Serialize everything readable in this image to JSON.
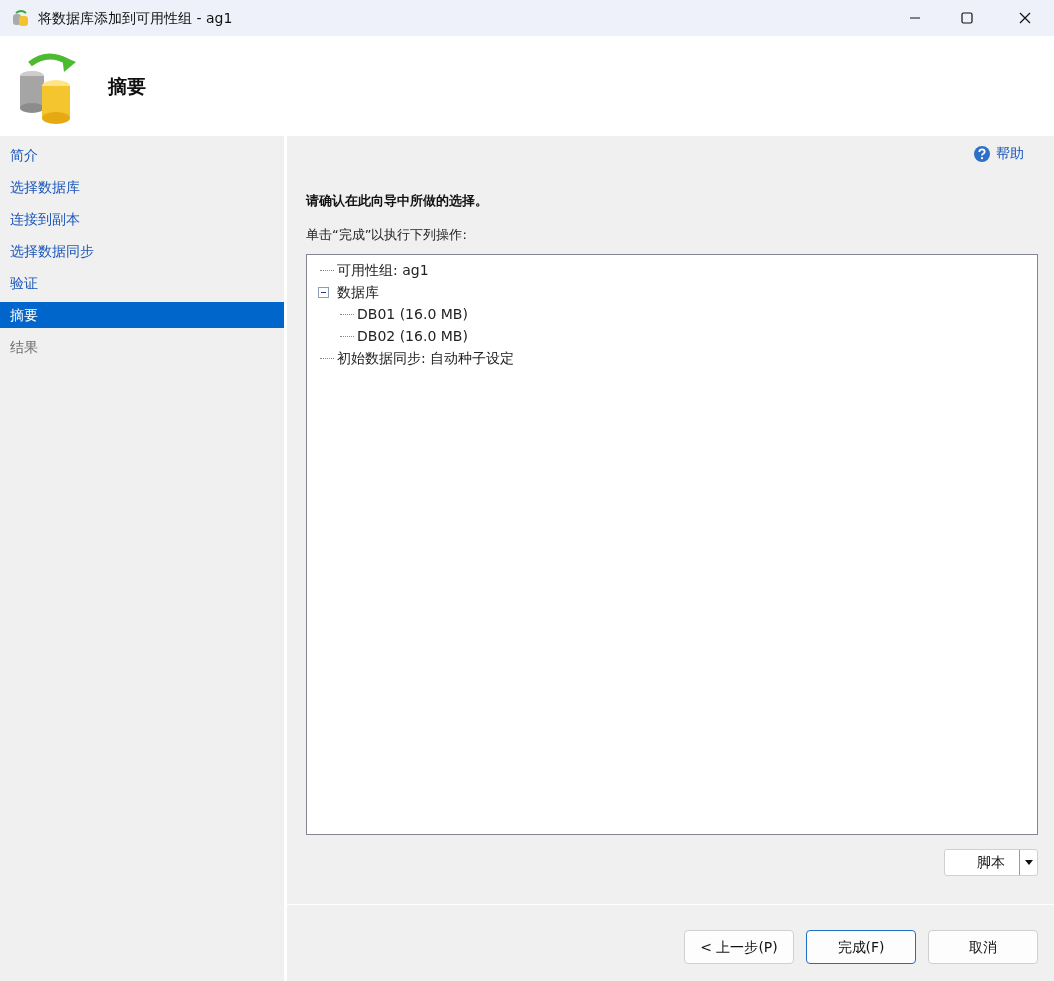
{
  "window": {
    "title": "将数据库添加到可用性组 - ag1"
  },
  "header": {
    "title": "摘要"
  },
  "sidebar": {
    "items": [
      {
        "label": "简介",
        "selected": false,
        "disabled": false
      },
      {
        "label": "选择数据库",
        "selected": false,
        "disabled": false
      },
      {
        "label": "连接到副本",
        "selected": false,
        "disabled": false
      },
      {
        "label": "选择数据同步",
        "selected": false,
        "disabled": false
      },
      {
        "label": "验证",
        "selected": false,
        "disabled": false
      },
      {
        "label": "摘要",
        "selected": true,
        "disabled": false
      },
      {
        "label": "结果",
        "selected": false,
        "disabled": true
      }
    ]
  },
  "help": {
    "label": "帮助"
  },
  "content": {
    "heading": "请确认在此向导中所做的选择。",
    "instruction": "单击“完成”以执行下列操作:"
  },
  "tree": [
    {
      "label": "可用性组: ag1"
    },
    {
      "label": "数据库",
      "expanded": true,
      "children": [
        {
          "label": "DB01 (16.0 MB)"
        },
        {
          "label": "DB02 (16.0 MB)"
        }
      ]
    },
    {
      "label": "初始数据同步: 自动种子设定"
    }
  ],
  "script_button": {
    "label": "脚本"
  },
  "buttons": [
    {
      "label": "< 上一步(P)",
      "kind": "normal"
    },
    {
      "label": "完成(F)",
      "kind": "default"
    },
    {
      "label": "取消",
      "kind": "normal"
    }
  ]
}
